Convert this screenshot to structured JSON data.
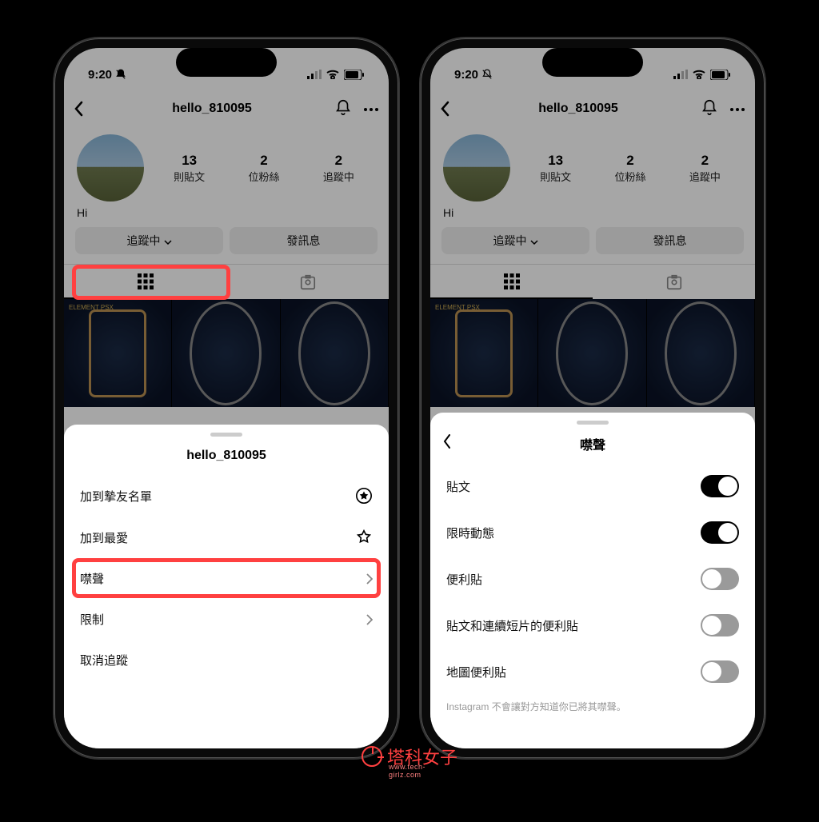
{
  "status": {
    "time": "9:20"
  },
  "profile": {
    "username": "hello_810095",
    "stats": {
      "posts_num": "13",
      "posts_lbl": "則貼文",
      "followers_num": "2",
      "followers_lbl": "位粉絲",
      "following_num": "2",
      "following_lbl": "追蹤中"
    },
    "bio": "Hi",
    "following_btn": "追蹤中",
    "message_btn": "發訊息",
    "grid_tag": "ELEMENT PSX"
  },
  "sheet1": {
    "title": "hello_810095",
    "items": {
      "close_friends": "加到摯友名單",
      "favorites": "加到最愛",
      "mute": "噤聲",
      "restrict": "限制",
      "unfollow": "取消追蹤"
    }
  },
  "sheet2": {
    "title": "噤聲",
    "items": {
      "posts": "貼文",
      "stories": "限時動態",
      "notes": "便利貼",
      "posts_reels_notes": "貼文和連續短片的便利貼",
      "map_notes": "地圖便利貼"
    },
    "note": "Instagram 不會讓對方知道你已將其噤聲。"
  },
  "watermark": {
    "main": "塔科女子",
    "sub": "www.tech-girlz.com"
  }
}
